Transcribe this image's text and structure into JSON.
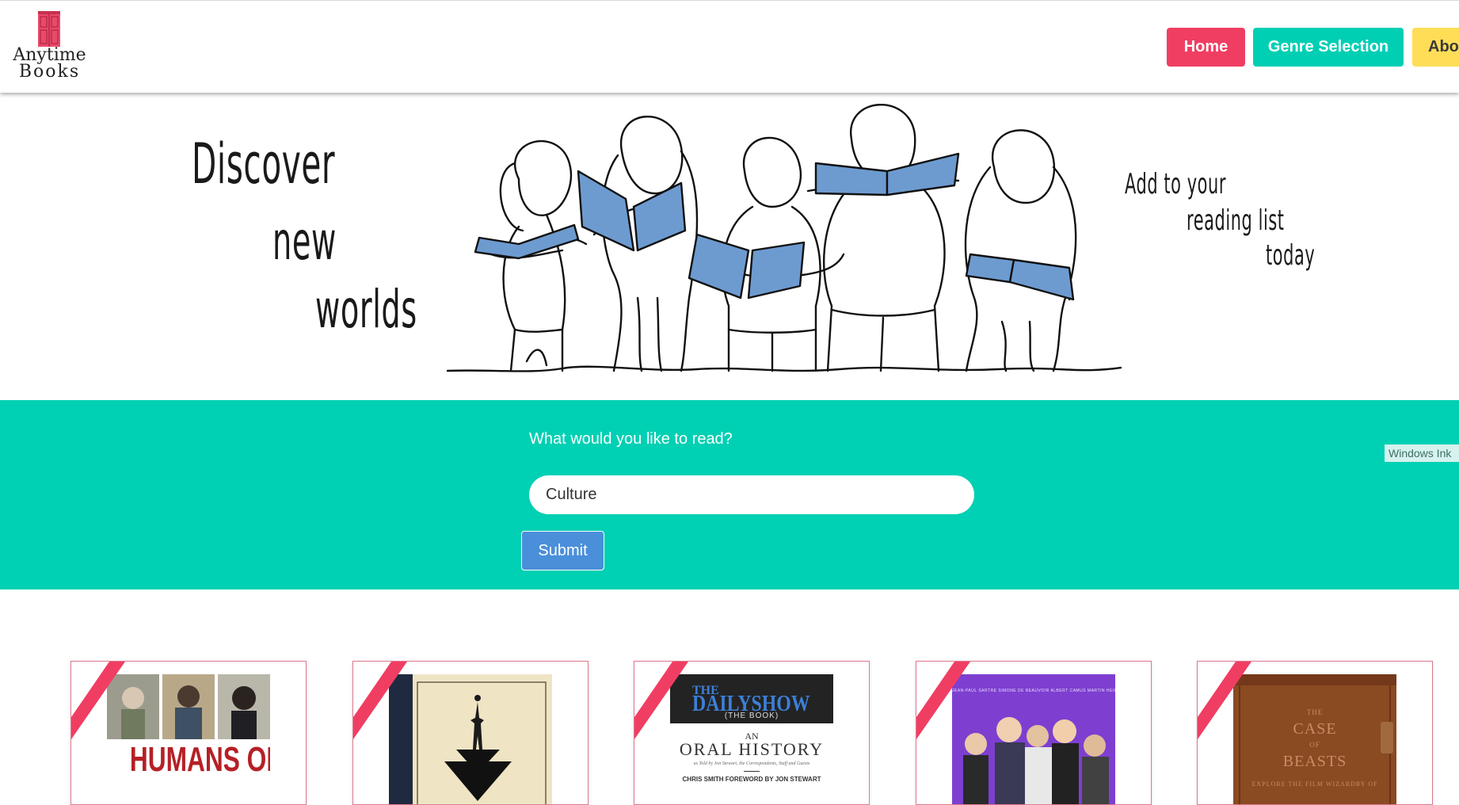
{
  "brand": {
    "line1": "Anytime",
    "line2": "Books"
  },
  "nav": [
    {
      "label": "Home",
      "color": "#f03e63"
    },
    {
      "label": "Genre Selection",
      "color": "#00cfb4"
    },
    {
      "label": "Abo",
      "color": "#ffdd57"
    }
  ],
  "hero": {
    "left_words": [
      "Discover",
      "new",
      "worlds"
    ],
    "right_words": [
      "Add to your",
      "reading list",
      "today"
    ]
  },
  "search": {
    "label": "What would you like to read?",
    "value": "Culture",
    "submit_label": "Submit",
    "band_color": "#00d0b3"
  },
  "overlay": {
    "ink_tag": "Windows Ink"
  },
  "books": [
    {
      "cover_title": "HUMANS OF"
    },
    {
      "cover_title": ""
    },
    {
      "cover_title_top": "THE",
      "cover_title_main": "DAILYSHOW",
      "cover_sub": "(THE BOOK)",
      "cover_an": "AN",
      "cover_oral": "ORAL HISTORY",
      "cover_told": "as Told by Jon Stewart, the Correspondents, Staff and Guests",
      "cover_authors": "CHRIS SMITH  FOREWORD BY JON STEWART"
    },
    {
      "cover_names": "JEAN-PAUL SARTRE  SIMONE DE BEAUVOIR  ALBERT CAMUS  MARTIN HEIDEGGER  EDMUND HUSSERL  KARL JASPERS  MAURICE MERLEAU-PONTY"
    },
    {
      "cover_title": [
        "THE",
        "CASE",
        "OF",
        "BEASTS"
      ],
      "cover_sub": "EXPLORE THE FILM WIZARDRY OF"
    }
  ]
}
